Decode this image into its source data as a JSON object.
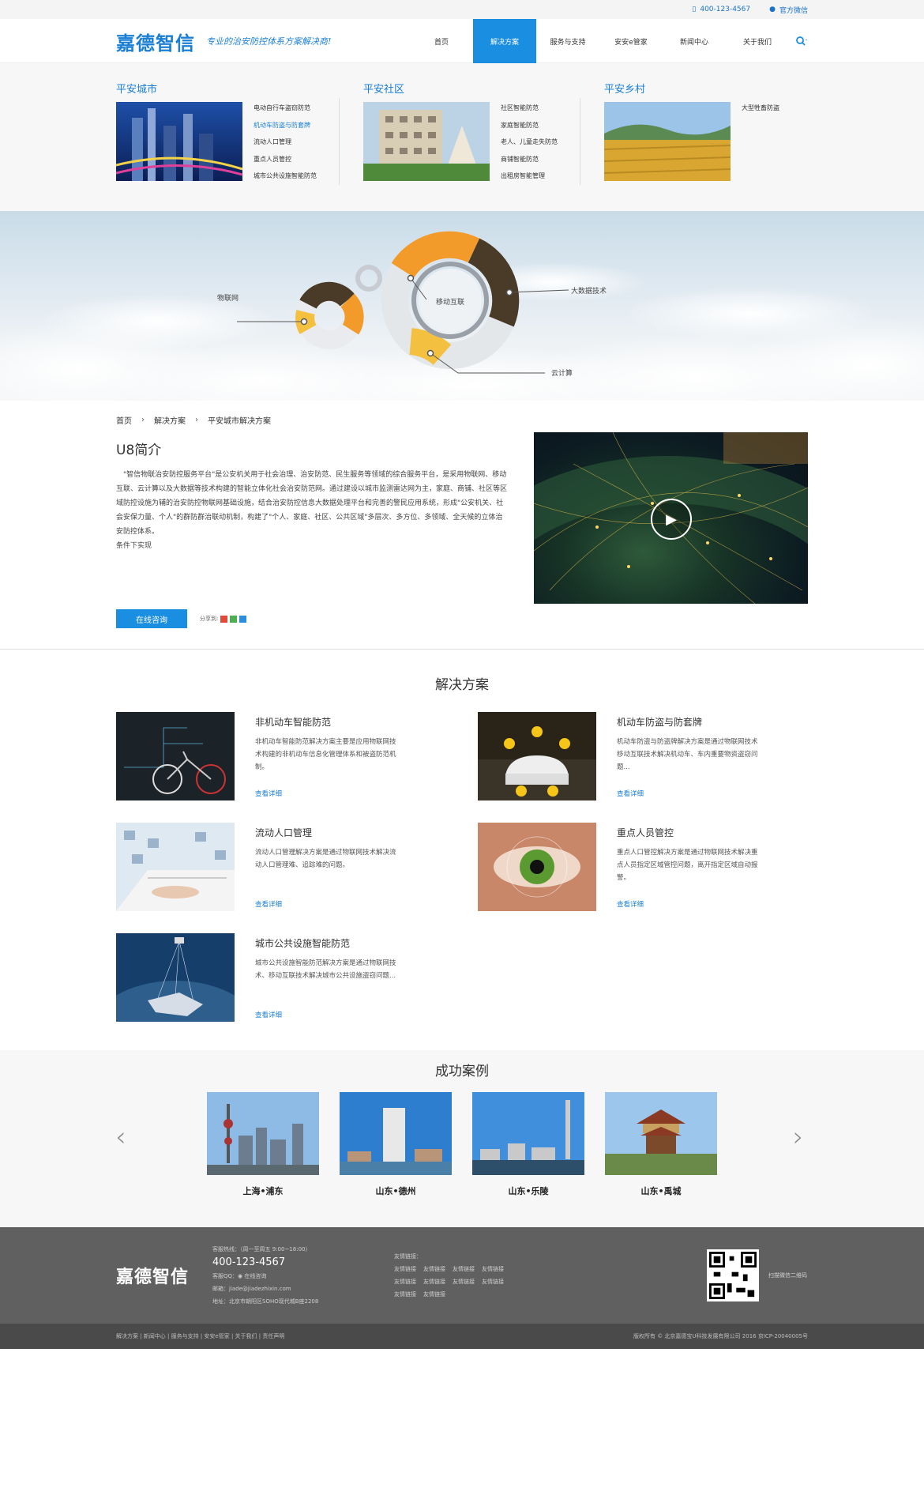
{
  "topbar": {
    "phone": "400-123-4567",
    "wechat": "官方微信"
  },
  "header": {
    "logo": "嘉德智信",
    "slogan": "专业的治安防控体系方案解决商!",
    "nav": [
      "首页",
      "解决方案",
      "服务与支持",
      "安安e管家",
      "新闻中心",
      "关于我们"
    ],
    "active_index": 1
  },
  "mega": [
    {
      "title": "平安城市",
      "items": [
        "电动自行车盗窃防范",
        "机动车防盗与防套牌",
        "流动人口管理",
        "重点人员管控",
        "城市公共设施智能防范"
      ],
      "highlight": 1
    },
    {
      "title": "平安社区",
      "items": [
        "社区智能防范",
        "家庭智能防范",
        "老人、儿童走失防范",
        "商铺智能防范",
        "出租房智能管理"
      ]
    },
    {
      "title": "平安乡村",
      "items": [
        "大型牲畜防盗"
      ]
    }
  ],
  "banner": {
    "labels": [
      "物联网",
      "移动互联",
      "大数据技术",
      "云计算"
    ]
  },
  "breadcrumb": [
    "首页",
    "解决方案",
    "平安城市解决方案"
  ],
  "intro": {
    "title": "U8简介",
    "paragraph": "\"智信物联治安防控服务平台\"是公安机关用于社会治理、治安防范、民生服务等领域的综合服务平台，是采用物联网、移动互联、云计算以及大数据等技术构建的智能立体化社会治安防范网。通过建设以城市监测雷达网为主，家庭、商铺、社区等区域防控设施为辅的治安防控物联网基础设施，结合治安防控信息大数据处理平台和完善的警民应用系统，形成\"公安机关、社会安保力量、个人\"的群防群治联动机制，构建了\"个人、家庭、社区、公共区域\"多层次、多方位、多领域、全天候的立体治安防控体系。",
    "note": "条件下实现",
    "consult": "在线咨询",
    "share": "分享到:"
  },
  "solutions": {
    "title": "解决方案",
    "more": "查看详细",
    "items": [
      {
        "name": "非机动车智能防范",
        "desc": "非机动车智能防范解决方案主要是应用物联网技术构建的非机动车信息化管理体系和被盗防范机制。"
      },
      {
        "name": "机动车防盗与防套牌",
        "desc": "机动车防盗与防盗牌解决方案是通过物联网技术移动互联技术解决机动车、车内重要物资盗窃问题..."
      },
      {
        "name": "流动人口管理",
        "desc": "流动人口管理解决方案是通过物联网技术解决流动人口管理难、追踪难的问题。"
      },
      {
        "name": "重点人员管控",
        "desc": "重点人口管控解决方案是通过物联网技术解决重点人员指定区域管控问题，离开指定区域自动报警。"
      },
      {
        "name": "城市公共设施智能防范",
        "desc": "城市公共设施智能防范解决方案是通过物联网技术、移动互联技术解决城市公共设施盗窃问题..."
      }
    ]
  },
  "cases": {
    "title": "成功案例",
    "items": [
      "上海•浦东",
      "山东•德州",
      "山东•乐陵",
      "山东•禹城"
    ]
  },
  "footer": {
    "logo": "嘉德智信",
    "hotline_label": "客服热线：（周一至周五 9:00~18:00）",
    "phone": "400-123-4567",
    "qq_label": "客服QQ：",
    "qq": "在线咨询",
    "email": "邮箱：jiade@jiadezhixin.com",
    "address": "地址：北京市朝阳区SOHO现代城B座2208",
    "links_title": "友情链接：",
    "links": [
      "友情链接",
      "友情链接",
      "友情链接",
      "友情链接",
      "友情链接",
      "友情链接",
      "友情链接",
      "友情链接",
      "友情链接",
      "友情链接"
    ],
    "qr_text": "扫描微信二维码"
  },
  "bottom": {
    "links": "解决方案 | 新闻中心 | 服务与支持 | 安安e管家 | 关于我们 | 责任声明",
    "copyright": "版权所有 © 北京嘉德宝U科技发展有限公司 2016 京ICP-20040005号"
  }
}
